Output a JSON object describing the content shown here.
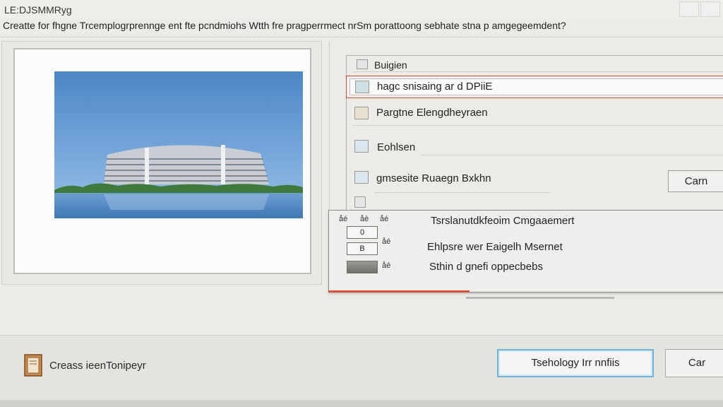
{
  "window": {
    "title": "LE:DJSMMRyg",
    "minimize_label": "",
    "close_label": ""
  },
  "header": {
    "text": "Creatte for fhgne Trcemplogrprennge ent fte pcndmiohs Wtth fre pragperrmect nrSm porattoong sebhate stna p amgegeemdent?"
  },
  "preview": {
    "image_description_icon": "photo-building"
  },
  "options": {
    "top_label": "Buigien",
    "items": [
      {
        "label": "hagc snisaing ar d DPiiE",
        "icon": "panel-icon",
        "selected": true
      },
      {
        "label": "Pargtne Elengdheyraen",
        "icon": "folder-icon",
        "selected": false
      },
      {
        "label": "Eohlsen",
        "icon": "grid-icon",
        "selected": false
      },
      {
        "label": "gmsesite Ruaegn Bxkhn",
        "icon": "table-icon",
        "selected": false
      }
    ],
    "side_button_label": "Carn"
  },
  "dropdown": {
    "header_marks": [
      "åé",
      "åè",
      "åé"
    ],
    "rows": [
      {
        "box": "0",
        "mark": "",
        "label": "Tsrslanutdkfeoim Cmgaaemert"
      },
      {
        "box": "B",
        "mark": "åé",
        "label": "Ehlpsre wer Eaigelh Msernet"
      },
      {
        "box": "",
        "mark": "åé",
        "label": "Sthin d gnefi oppecbebs"
      }
    ]
  },
  "footer": {
    "label": "Creass ieenTonipeyr",
    "primary_button": "Tsehology Irr nnfiis",
    "cancel_button": "Car"
  },
  "colors": {
    "accent_red": "#d2452c",
    "focus_blue": "#6fb4d6",
    "background": "#ecebe8"
  }
}
